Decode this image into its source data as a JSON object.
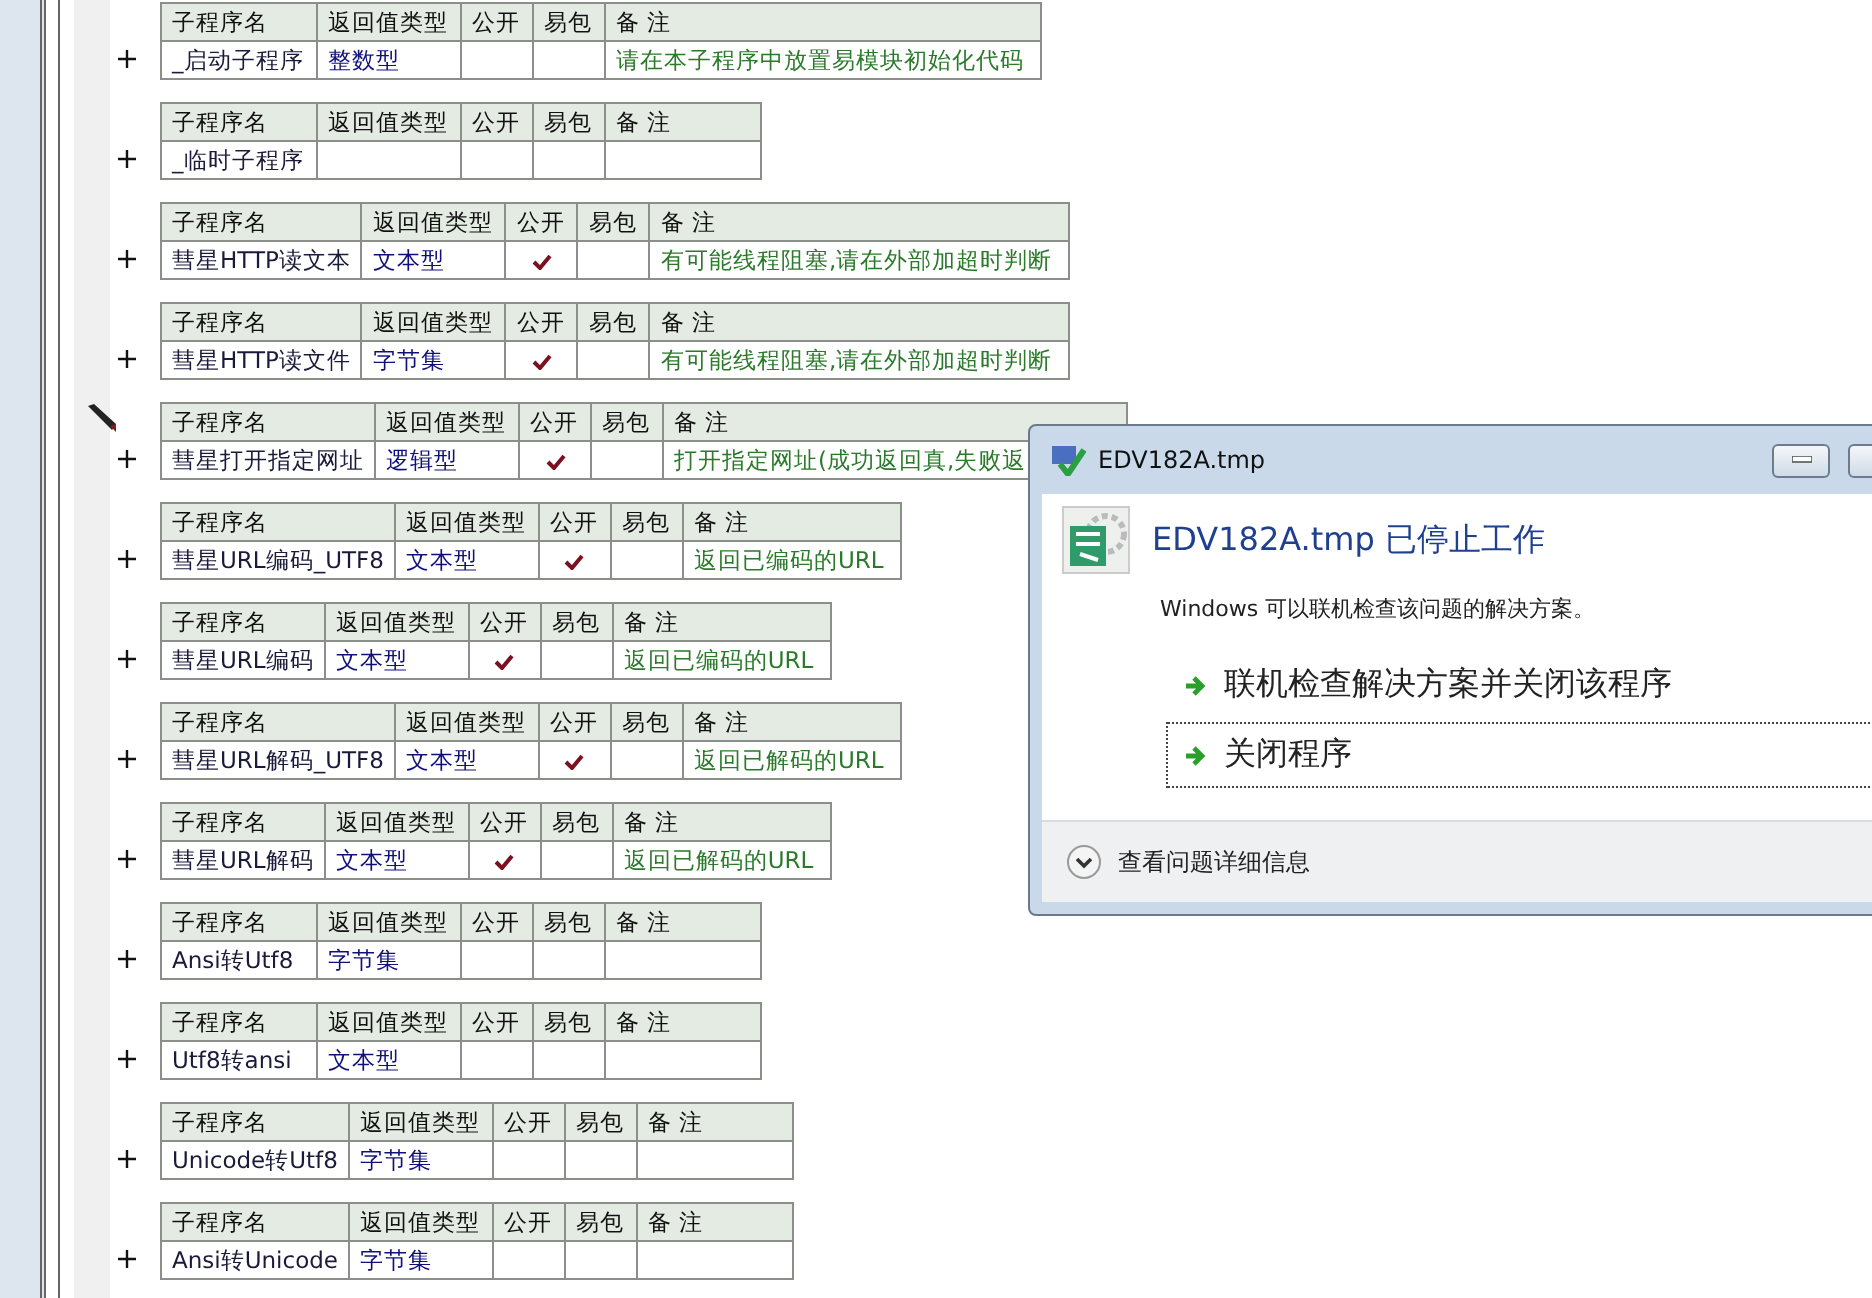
{
  "subs": [
    {
      "headers": [
        "子程序名",
        "返回值类型",
        "公开",
        "易包",
        "备 注"
      ],
      "name": "_启动子程序",
      "type": "整数型",
      "public": false,
      "note": "请在本子程序中放置易模块初始化代码",
      "current": false
    },
    {
      "headers": [
        "子程序名",
        "返回值类型",
        "公开",
        "易包",
        "备 注"
      ],
      "name": "_临时子程序",
      "public": false,
      "current": false
    },
    {
      "headers": [
        "子程序名",
        "返回值类型",
        "公开",
        "易包",
        "备 注"
      ],
      "name": "彗星HTTP读文本",
      "type": "文本型",
      "public": true,
      "note": "有可能线程阻塞,请在外部加超时判断",
      "current": false
    },
    {
      "headers": [
        "子程序名",
        "返回值类型",
        "公开",
        "易包",
        "备 注"
      ],
      "name": "彗星HTTP读文件",
      "type": "字节集",
      "public": true,
      "note": "有可能线程阻塞,请在外部加超时判断",
      "current": false
    },
    {
      "headers": [
        "子程序名",
        "返回值类型",
        "公开",
        "易包",
        "备 注"
      ],
      "name": "彗星打开指定网址",
      "type": "逻辑型",
      "public": true,
      "note": "打开指定网址(成功返回真,失败返",
      "current": true
    },
    {
      "headers": [
        "子程序名",
        "返回值类型",
        "公开",
        "易包",
        "备 注"
      ],
      "name": "彗星URL编码_UTF8",
      "type": "文本型",
      "public": true,
      "note": "返回已编码的URL",
      "current": false
    },
    {
      "headers": [
        "子程序名",
        "返回值类型",
        "公开",
        "易包",
        "备 注"
      ],
      "name": "彗星URL编码",
      "type": "文本型",
      "public": true,
      "note": "返回已编码的URL",
      "current": false
    },
    {
      "headers": [
        "子程序名",
        "返回值类型",
        "公开",
        "易包",
        "备 注"
      ],
      "name": "彗星URL解码_UTF8",
      "type": "文本型",
      "public": true,
      "note": "返回已解码的URL",
      "current": false
    },
    {
      "headers": [
        "子程序名",
        "返回值类型",
        "公开",
        "易包",
        "备 注"
      ],
      "name": "彗星URL解码",
      "type": "文本型",
      "public": true,
      "note": "返回已解码的URL",
      "current": false
    },
    {
      "headers": [
        "子程序名",
        "返回值类型",
        "公开",
        "易包",
        "备 注"
      ],
      "name": "Ansi转Utf8",
      "type": "字节集",
      "public": false,
      "current": false
    },
    {
      "headers": [
        "子程序名",
        "返回值类型",
        "公开",
        "易包",
        "备 注"
      ],
      "name": "Utf8转ansi",
      "type": "文本型",
      "public": false,
      "current": false
    },
    {
      "headers": [
        "子程序名",
        "返回值类型",
        "公开",
        "易包",
        "备 注"
      ],
      "name": "Unicode转Utf8",
      "type": "字节集",
      "public": false,
      "current": false
    },
    {
      "headers": [
        "子程序名",
        "返回值类型",
        "公开",
        "易包",
        "备 注"
      ],
      "name": "Ansi转Unicode",
      "type": "字节集",
      "public": false,
      "current": false
    }
  ],
  "dialog": {
    "title": "EDV182A.tmp",
    "heading": "EDV182A.tmp 已停止工作",
    "message": "Windows 可以联机检查该问题的解决方案。",
    "options": [
      {
        "label": "联机检查解决方案并关闭该程序",
        "focused": false
      },
      {
        "label": "关闭程序",
        "focused": true
      }
    ],
    "details": "查看问题详细信息"
  }
}
